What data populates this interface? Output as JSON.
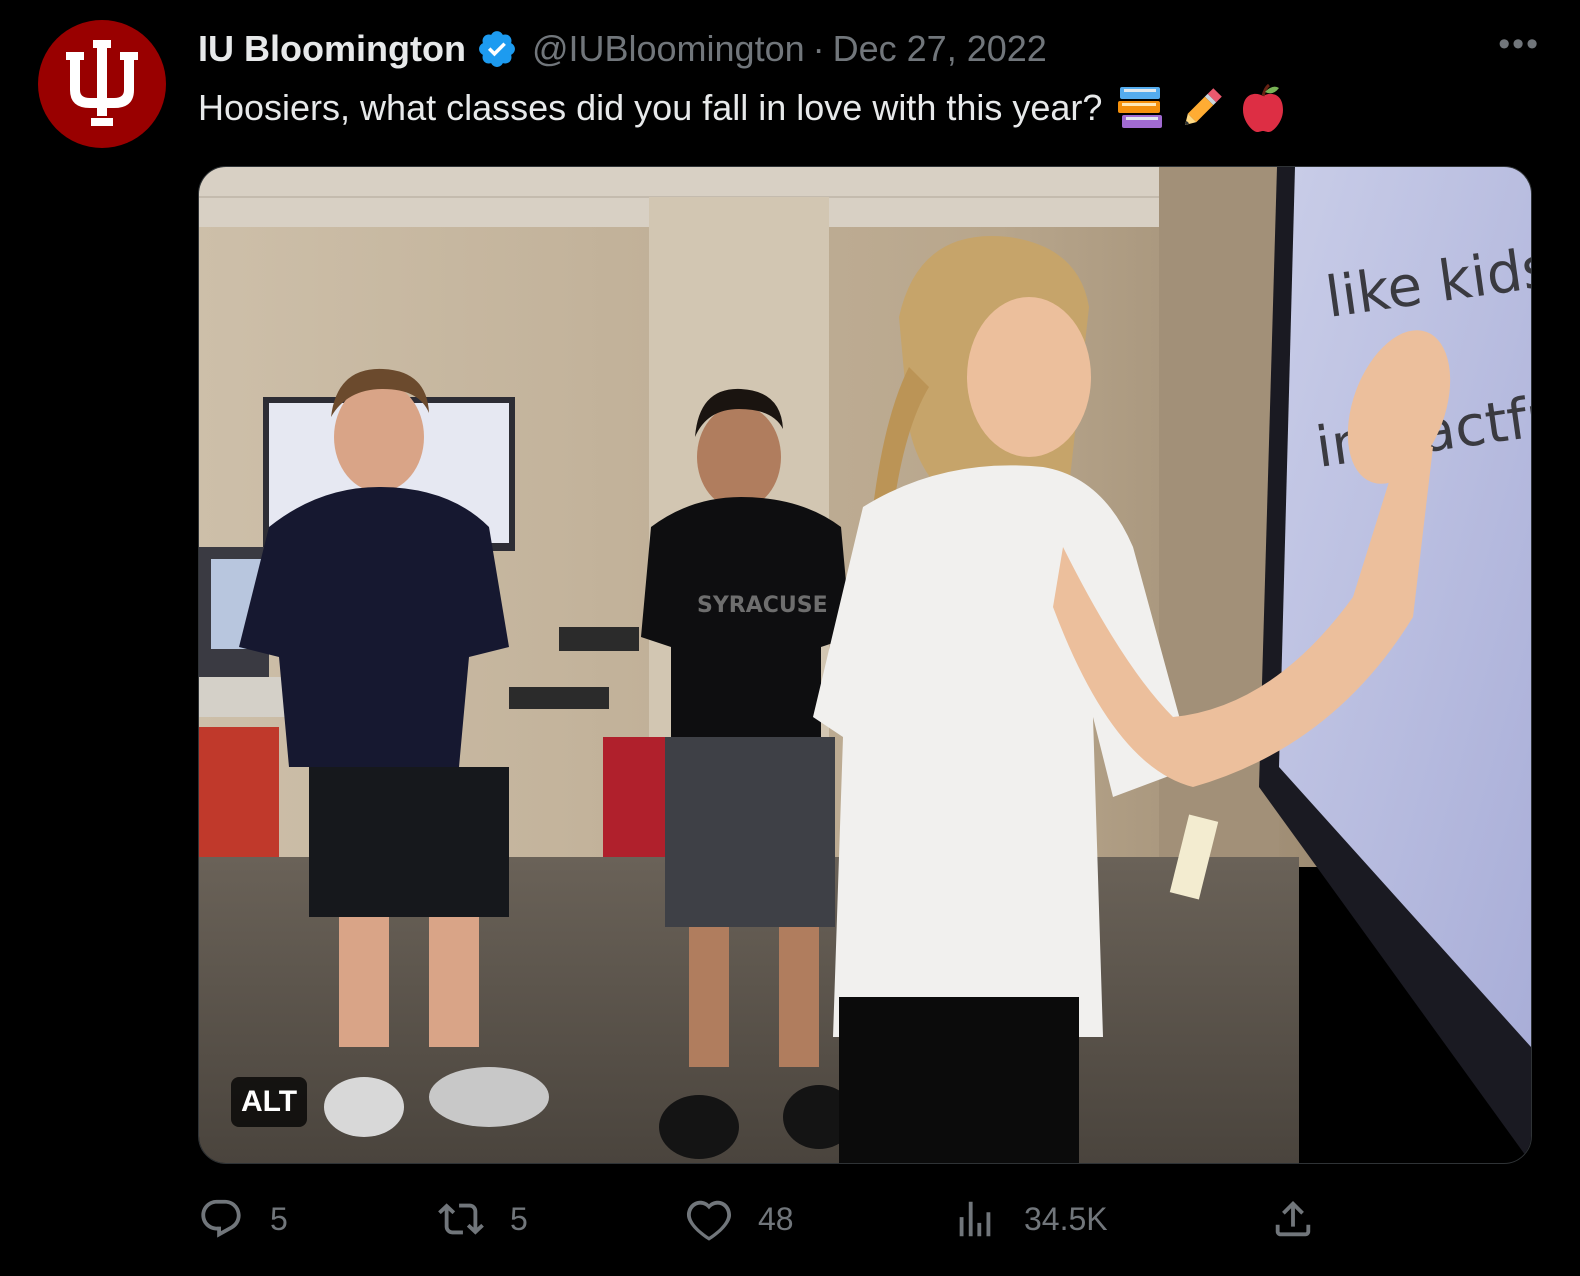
{
  "tweet": {
    "author_name": "IU Bloomington",
    "handle": "@IUBloomington",
    "separator": "·",
    "date": "Dec 27, 2022",
    "text": "Hoosiers, what classes did you fall in love with this year?",
    "emojis": [
      "books-emoji",
      "pencil-emoji",
      "apple-emoji"
    ],
    "more_label": "•••"
  },
  "media": {
    "alt_label": "ALT",
    "whiteboard_text_1": "like kids",
    "whiteboard_text_2": "impactful",
    "shirt_text": "SYRACUSE"
  },
  "actions": {
    "replies": "5",
    "retweets": "5",
    "likes": "48",
    "views": "34.5K"
  },
  "colors": {
    "background": "#000000",
    "text": "#e7e9ea",
    "muted": "#71767b",
    "iu_crimson": "#990000",
    "verified_blue": "#1d9bf0"
  }
}
